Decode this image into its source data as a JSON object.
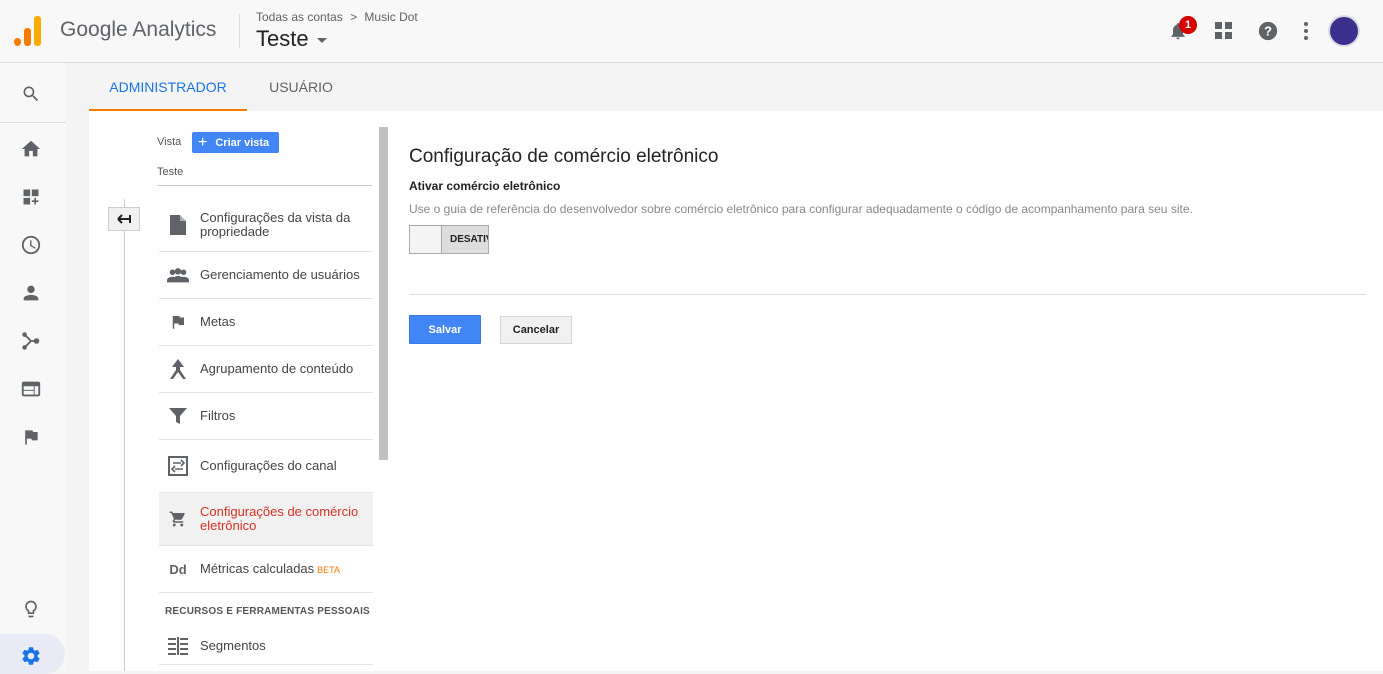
{
  "app": {
    "title": "Google Analytics"
  },
  "breadcrumb": {
    "root": "Todas as contas",
    "separator": ">",
    "account": "Music Dot"
  },
  "view_selector": {
    "value": "Teste"
  },
  "notifications": {
    "count": "1"
  },
  "tabs": [
    {
      "label": "ADMINISTRADOR",
      "active": true
    },
    {
      "label": "USUÁRIO",
      "active": false
    }
  ],
  "view_column": {
    "label": "Vista",
    "create_button": "Criar vista",
    "selected": "Teste"
  },
  "menu": [
    {
      "label": "Configurações da vista da propriedade",
      "icon": "document-icon"
    },
    {
      "label": "Gerenciamento de usuários",
      "icon": "people-icon"
    },
    {
      "label": "Metas",
      "icon": "flag-icon"
    },
    {
      "label": "Agrupamento de conteúdo",
      "icon": "grouping-icon"
    },
    {
      "label": "Filtros",
      "icon": "filter-icon"
    },
    {
      "label": "Configurações do canal",
      "icon": "channel-icon"
    },
    {
      "label": "Configurações de comércio eletrônico",
      "icon": "cart-icon",
      "active": true
    },
    {
      "label": "Métricas calculadas",
      "badge": "BETA",
      "icon": "dd-icon"
    }
  ],
  "section": {
    "title": "RECURSOS E FERRAMENTAS PESSOAIS"
  },
  "segments": {
    "label": "Segmentos",
    "icon": "segments-icon"
  },
  "panel": {
    "title": "Configuração de comércio eletrônico",
    "subtitle": "Ativar comércio eletrônico",
    "description": "Use o guia de referência do desenvolvedor sobre comércio eletrônico para configurar adequadamente o código de acompanhamento para seu site.",
    "toggle_label": "DESATIVADO",
    "toggle_on": false,
    "save_label": "Salvar",
    "cancel_label": "Cancelar"
  },
  "colors": {
    "accent": "#1a73e8",
    "primary_button": "#4285f4",
    "active_item": "#d93025",
    "tab_underline": "#f57c00"
  }
}
